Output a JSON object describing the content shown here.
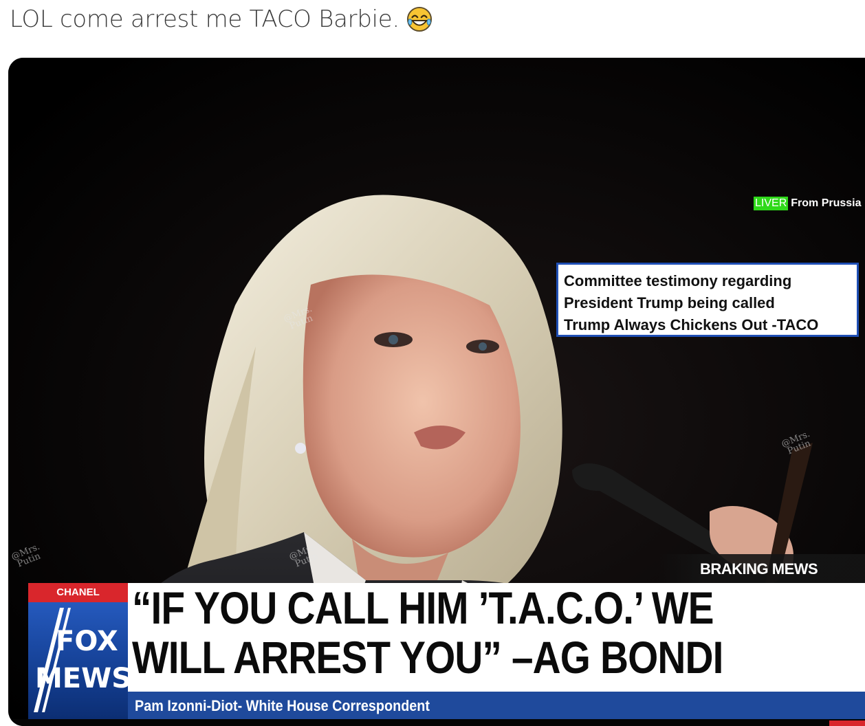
{
  "post": {
    "text": "LOL come arrest me TACO Barbie.",
    "emoji_icon": "face-with-tears-of-joy-icon"
  },
  "image": {
    "live_badge": "LIVER",
    "live_location": "From Prussia",
    "committee_box": {
      "lines": [
        "Committee testimony regarding",
        "President Trump  being called",
        "Trump Always Chickens Out -TACO"
      ]
    },
    "watermarks": [
      "@Mrs.",
      "Putin"
    ],
    "braking_label": "BRAKING MEWS",
    "channel": {
      "bar_label": "CHANEL",
      "logo_line1": "FOX",
      "logo_line2": "MEWS"
    },
    "headline_line1": "“IF YOU CALL HIM ’T.A.C.O.’ WE",
    "headline_line2": "WILL ARREST YOU” –AG BONDI",
    "byline": "Pam Izonni-Diot-  White House Correspondent",
    "colors": {
      "accent_red": "#d9262c",
      "network_blue": "#1f4a9c",
      "live_green": "#2fd91a"
    }
  }
}
